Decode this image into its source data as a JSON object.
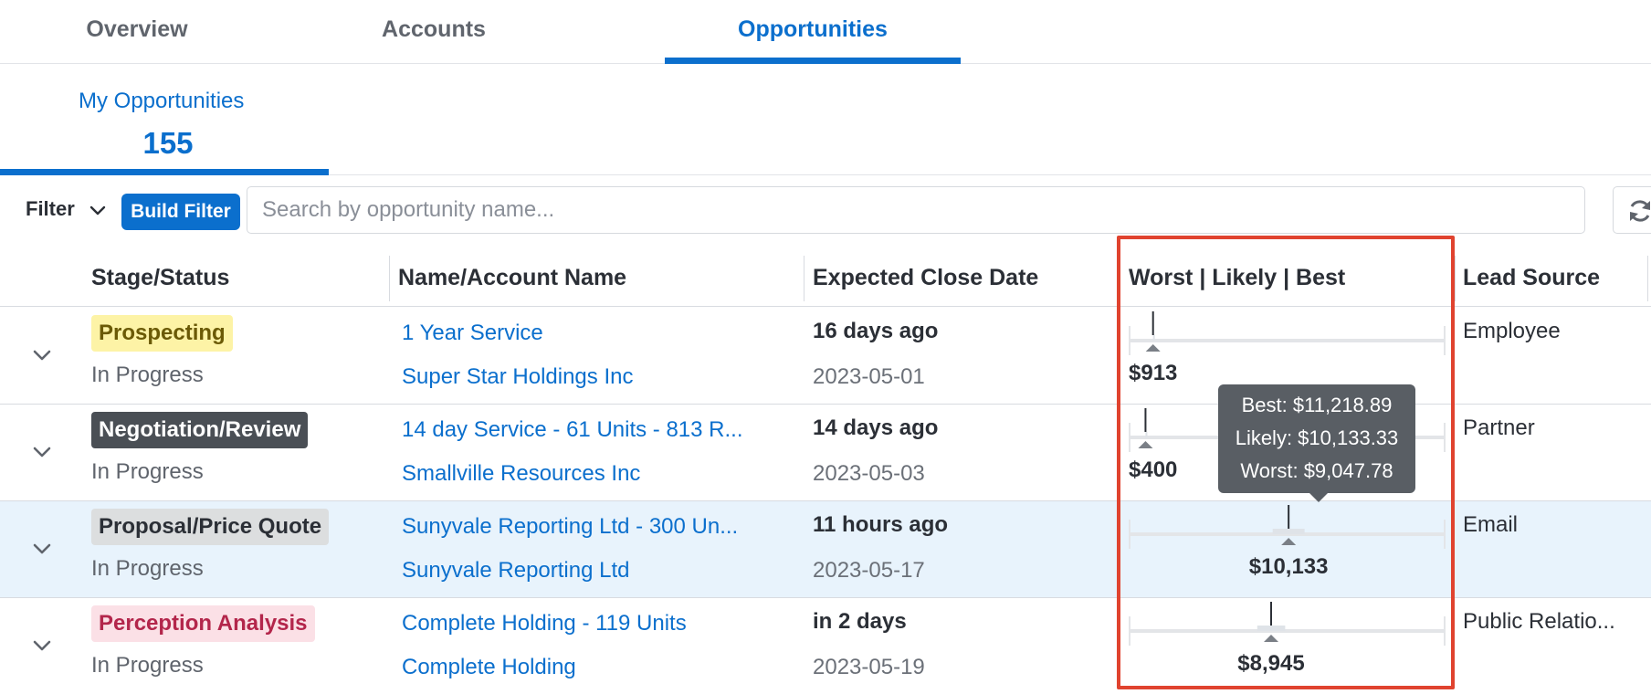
{
  "tabs": [
    {
      "label": "Overview"
    },
    {
      "label": "Accounts"
    },
    {
      "label": "Opportunities",
      "active": true
    }
  ],
  "summary": {
    "label": "My Opportunities",
    "count": "155"
  },
  "filter": {
    "label": "Filter",
    "build_filter_label": "Build Filter",
    "search_placeholder": "Search by opportunity name..."
  },
  "columns": [
    "Stage/Status",
    "Name/Account Name",
    "Expected Close Date",
    "Worst | Likely | Best",
    "Lead Source"
  ],
  "rows": [
    {
      "stage": "Prospecting",
      "stage_bg": "#fdf3a6",
      "stage_fg": "#6b5a06",
      "status": "In Progress",
      "name": "1 Year Service",
      "account": "Super Star Holdings Inc",
      "relative_close": "16 days ago",
      "close_date": "2023-05-01",
      "forecast": {
        "worst": 913,
        "likely": 913,
        "best": 913,
        "amount_label": "$913"
      },
      "lead_source": "Employee"
    },
    {
      "stage": "Negotiation/Review",
      "stage_bg": "#4a4f55",
      "stage_fg": "#ffffff",
      "status": "In Progress",
      "name": "14 day Service - 61 Units - 813 R...",
      "account": "Smallville Resources Inc",
      "relative_close": "14 days ago",
      "close_date": "2023-05-03",
      "forecast": {
        "worst": 400,
        "likely": 400,
        "best": 400,
        "amount_label": "$400"
      },
      "lead_source": "Partner"
    },
    {
      "stage": "Proposal/Price Quote",
      "stage_bg": "#dcdedf",
      "stage_fg": "#2b2f36",
      "status": "In Progress",
      "name": "Sunyvale Reporting Ltd - 300 Un...",
      "account": "Sunyvale Reporting Ltd",
      "relative_close": "11 hours ago",
      "close_date": "2023-05-17",
      "forecast": {
        "worst": 9047.78,
        "likely": 10133.33,
        "best": 11218.89,
        "amount_label": "$10,133"
      },
      "lead_source": "Email",
      "highlighted": true
    },
    {
      "stage": "Perception Analysis",
      "stage_bg": "#fbe0e6",
      "stage_fg": "#b3264b",
      "status": "In Progress",
      "name": "Complete Holding - 119 Units",
      "account": "Complete Holding",
      "relative_close": "in 2 days",
      "close_date": "2023-05-19",
      "forecast": {
        "worst": 8000,
        "likely": 8945,
        "best": 9900,
        "amount_label": "$8,945"
      },
      "lead_source": "Public Relatio..."
    }
  ],
  "forecast_scale": {
    "min": 0,
    "max": 20000
  },
  "tooltip": {
    "best": "Best: $11,218.89",
    "likely": "Likely: $10,133.33",
    "worst": "Worst: $9,047.78"
  },
  "colors": {
    "accent": "#0b6fcd",
    "highlight_border": "#e0432f",
    "row_highlight": "#e8f3fc"
  }
}
